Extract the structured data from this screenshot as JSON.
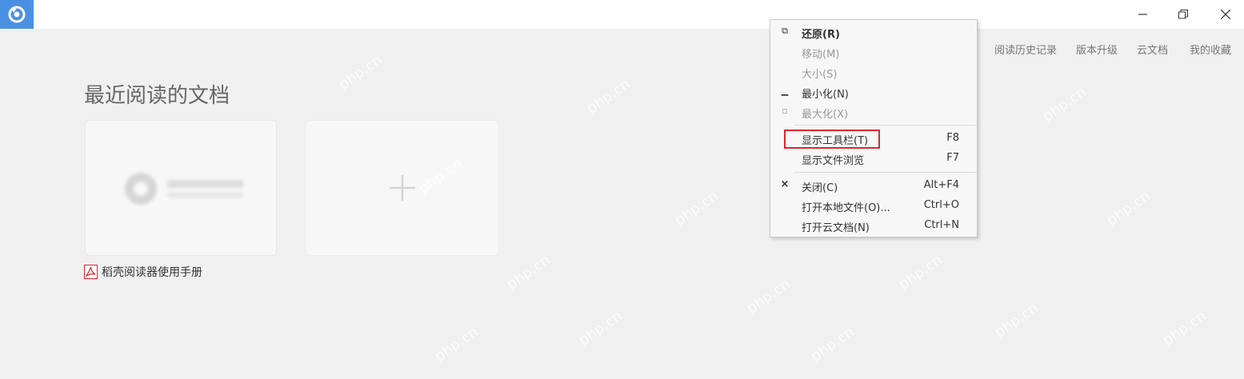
{
  "titlebar": {
    "logo_icon": "app-logo-icon",
    "window_controls": [
      "minimize-icon",
      "restore-icon",
      "close-icon"
    ]
  },
  "nav": {
    "items": [
      {
        "label": "阅读历史记录"
      },
      {
        "label": "版本升级"
      },
      {
        "label": "云文档"
      },
      {
        "label": "我的收藏"
      }
    ]
  },
  "main": {
    "section_title": "最近阅读的文档",
    "recent_file": {
      "name": "稻壳阅读器使用手册",
      "icon": "pdf-icon"
    },
    "add_card_icon": "plus-icon"
  },
  "context_menu": {
    "items": [
      {
        "glyph": "⧉",
        "label": "还原(R)",
        "shortcut": "",
        "disabled": false,
        "bold": true
      },
      {
        "glyph": "",
        "label": "移动(M)",
        "shortcut": "",
        "disabled": true
      },
      {
        "glyph": "",
        "label": "大小(S)",
        "shortcut": "",
        "disabled": true
      },
      {
        "glyph": "▁",
        "label": "最小化(N)",
        "shortcut": "",
        "disabled": false
      },
      {
        "glyph": "▫",
        "label": "最大化(X)",
        "shortcut": "",
        "disabled": true
      },
      {
        "glyph": "",
        "label": "显示工具栏(T)",
        "shortcut": "F8",
        "disabled": false
      },
      {
        "glyph": "",
        "label": "显示文件浏览",
        "shortcut": "F7",
        "disabled": false
      },
      {
        "glyph": "×",
        "label": "关闭(C)",
        "shortcut": "Alt+F4",
        "disabled": false
      },
      {
        "glyph": "",
        "label": "打开本地文件(O)...",
        "shortcut": "Ctrl+O",
        "disabled": false
      },
      {
        "glyph": "",
        "label": "打开云文档(N)",
        "shortcut": "Ctrl+N",
        "disabled": false
      }
    ],
    "highlight_color": "#d9272e"
  },
  "watermark": "php.cn",
  "colors": {
    "logo_bg": "#4a90e2",
    "pdf_red": "#d9272e"
  }
}
